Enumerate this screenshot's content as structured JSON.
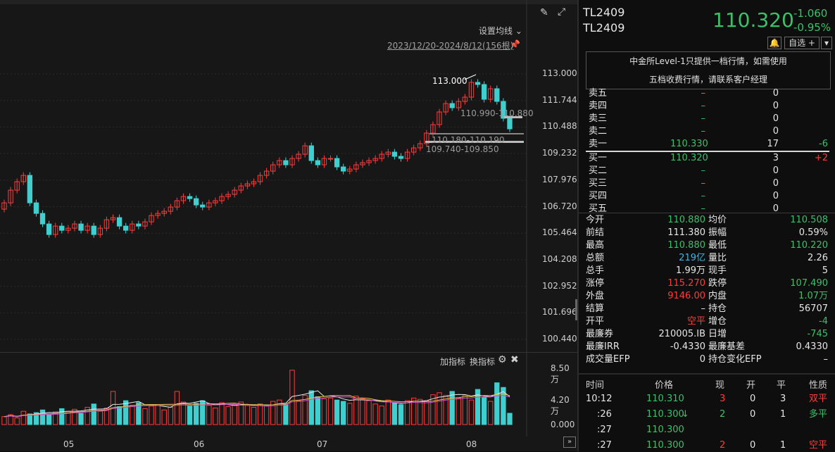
{
  "chart": {
    "setting_label": "设置均线",
    "range_label": "2023/12/20-2024/8/12(156根)",
    "peak_label": "113.000",
    "gap_labels": [
      "110.990-110.880",
      "110.180-110.190",
      "109.740-109.850"
    ],
    "indicator_add": "加指标",
    "indicator_switch": "换指标",
    "y_ticks": [
      "113.000",
      "111.744",
      "110.488",
      "109.232",
      "107.976",
      "106.720",
      "105.464",
      "104.208",
      "102.952",
      "101.696",
      "100.440"
    ],
    "vol_ticks": [
      "8.50万",
      "4.20万",
      "0.000"
    ],
    "x_months": [
      "05",
      "06",
      "07",
      "08"
    ],
    "colors": {
      "up": "#ff3b3b",
      "down": "#3fcfcf",
      "ma1": "#e8e8e8",
      "ma2": "#e0c040",
      "ma3": "#d04cd0"
    }
  },
  "quote": {
    "symbol1": "TL2409",
    "symbol2": "TL2409",
    "last": "110.320",
    "change": "-1.060",
    "change_pct": "-0.95%",
    "watchlist_btn": "自选 +",
    "notice_line1": "中金所Level-1只提供一档行情，如需使用",
    "notice_line2": "五档收费行情，请联系客户经理",
    "asks": [
      {
        "label": "卖五",
        "price": "–",
        "vol": "0",
        "chg": ""
      },
      {
        "label": "卖四",
        "price": "–",
        "vol": "0",
        "chg": ""
      },
      {
        "label": "卖三",
        "price": "–",
        "vol": "0",
        "chg": ""
      },
      {
        "label": "卖二",
        "price": "–",
        "vol": "0",
        "chg": ""
      },
      {
        "label": "卖一",
        "price": "110.330",
        "vol": "17",
        "chg": "-6"
      }
    ],
    "bids": [
      {
        "label": "买一",
        "price": "110.320",
        "vol": "3",
        "chg": "+2"
      },
      {
        "label": "买二",
        "price": "–",
        "vol": "0",
        "chg": ""
      },
      {
        "label": "买三",
        "price": "–",
        "vol": "0",
        "chg": ""
      },
      {
        "label": "买四",
        "price": "–",
        "vol": "0",
        "chg": ""
      },
      {
        "label": "买五",
        "price": "–",
        "vol": "0",
        "chg": ""
      }
    ],
    "stats": [
      {
        "l1": "今开",
        "v1": "110.880",
        "c1": "green",
        "l2": "均价",
        "v2": "110.508",
        "c2": "green"
      },
      {
        "l1": "前结",
        "v1": "111.380",
        "c1": "white",
        "l2": "振幅",
        "v2": "0.59%",
        "c2": "white"
      },
      {
        "l1": "最高",
        "v1": "110.880",
        "c1": "green",
        "l2": "最低",
        "v2": "110.220",
        "c2": "green"
      },
      {
        "l1": "总额",
        "v1": "219亿",
        "c1": "cyan",
        "l2": "量比",
        "v2": "2.26",
        "c2": "white"
      },
      {
        "l1": "总手",
        "v1": "1.99万",
        "c1": "white",
        "l2": "现手",
        "v2": "5",
        "c2": "white"
      },
      {
        "l1": "涨停",
        "v1": "115.270",
        "c1": "red",
        "l2": "跌停",
        "v2": "107.490",
        "c2": "green"
      },
      {
        "l1": "外盘",
        "v1": "9146.00",
        "c1": "red",
        "l2": "内盘",
        "v2": "1.07万",
        "c2": "green"
      },
      {
        "l1": "结算",
        "v1": "–",
        "c1": "white",
        "l2": "持仓",
        "v2": "56707",
        "c2": "white"
      },
      {
        "l1": "开平",
        "v1": "空平",
        "c1": "red",
        "l2": "增仓",
        "v2": "-4",
        "c2": "green"
      },
      {
        "l1": "最廉券",
        "v1": "210005.IB",
        "c1": "white",
        "l2": "日增",
        "v2": "-745",
        "c2": "green"
      },
      {
        "l1": "最廉IRR",
        "v1": "-0.4330",
        "c1": "white",
        "l2": "最廉基差",
        "v2": "0.4330",
        "c2": "white"
      },
      {
        "l1": "成交量EFP",
        "v1": "0",
        "c1": "white",
        "l2": "持仓变化EFP",
        "v2": "–",
        "c2": "white"
      }
    ],
    "ticks_header": [
      "时间",
      "价格",
      "现",
      "开",
      "平",
      "性质"
    ],
    "ticks": [
      {
        "time": "10:12",
        "price": "110.310",
        "now": "3",
        "open": "0",
        "close": "3",
        "nature": "双平",
        "now_c": "red",
        "nature_c": "red",
        "arrow": ""
      },
      {
        "time": ":26",
        "price": "110.300",
        "now": "2",
        "open": "0",
        "close": "1",
        "nature": "多平",
        "now_c": "green",
        "nature_c": "green",
        "arrow": "↓"
      },
      {
        "time": ":27",
        "price": "110.300",
        "now": "",
        "open": "",
        "close": "",
        "nature": "",
        "now_c": "green",
        "nature_c": "green",
        "arrow": ""
      },
      {
        "time": ":27",
        "price": "110.300",
        "now": "2",
        "open": "0",
        "close": "1",
        "nature": "空平",
        "now_c": "red",
        "nature_c": "red",
        "arrow": ""
      }
    ]
  }
}
